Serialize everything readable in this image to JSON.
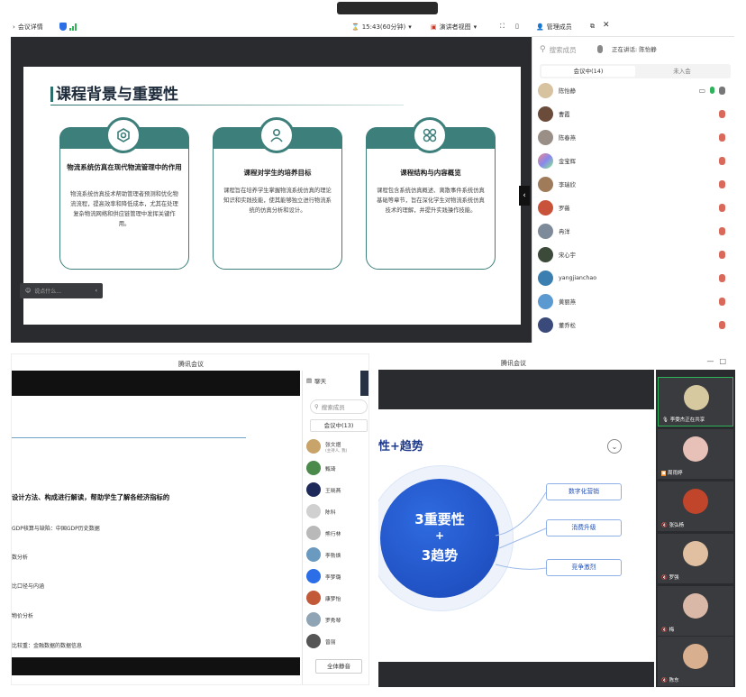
{
  "top": {
    "toolbar": {
      "meeting_details": "会议详情",
      "timer": "15:43(60分钟)",
      "speaker_view": "演讲者视图",
      "manage_members": "管理成员"
    },
    "slide": {
      "title": "课程背景与重要性",
      "cards": [
        {
          "title": "物流系统仿真在现代物流管理中的作用",
          "text": "物流系统仿真技术帮助管理者预测和优化物流流程，提高效率和降低成本，尤其在处理复杂物流网络和供应链管理中发挥关键作用。"
        },
        {
          "title": "课程对学生的培养目标",
          "text": "课程旨在培养学生掌握物流系统仿真的理论知识和实践技能，使其能够独立进行物流系统的仿真分析和设计。"
        },
        {
          "title": "课程结构与内容概览",
          "text": "课程包含系统仿真概述、离散事件系统仿真基础等章节，旨在深化学生对物流系统仿真技术的理解，并提升实践操作技能。"
        }
      ]
    },
    "chat_placeholder": "说点什么...",
    "panel": {
      "search_placeholder": "搜索成员",
      "speaking": "正在讲话: 陈怡静",
      "tab_in_meeting": "会议中(14)",
      "tab_not_joined": "未入会",
      "members": [
        "陈怡静",
        "曹霞",
        "陈春燕",
        "金宝辉",
        "李瑞欣",
        "罗薇",
        "冉洋",
        "宋心宇",
        "yangjianchao",
        "黄丽燕",
        "董乔松"
      ]
    }
  },
  "bottom_left": {
    "window_title": "腾讯会议",
    "heading": "设计方法、构成进行解读，帮助学生了解各经济指标的",
    "lines": [
      "GDP核算与缺陷：中国GDP历史数据",
      "数分析",
      "比口径与内涵",
      "物价分析",
      "比较重：金融数据的数据信息"
    ],
    "panel": {
      "chat_label": "聊天",
      "search_placeholder": "搜索成员",
      "count": "会议中(13)",
      "host_sub": "(主持人, 我)",
      "members": [
        "张文煜",
        "甄琦",
        "王晓燕",
        "陈科",
        "熊行林",
        "李勃焕",
        "李梦璐",
        "康梦怡",
        "罗秀琴",
        "曾丽"
      ],
      "mute_all": "全体静音"
    }
  },
  "bottom_right": {
    "window_title": "腾讯会议",
    "slide": {
      "heading": "性+趋势",
      "circle_line1": "3重要性",
      "circle_line2": "+",
      "circle_line3": "3趋势",
      "pills": [
        "数字化营销",
        "消费升级",
        "竞争激烈"
      ]
    },
    "tiles": [
      "李雯杰正在共享",
      "周雨婷",
      "张弘杨",
      "罗强",
      "梅",
      "陈东"
    ]
  }
}
